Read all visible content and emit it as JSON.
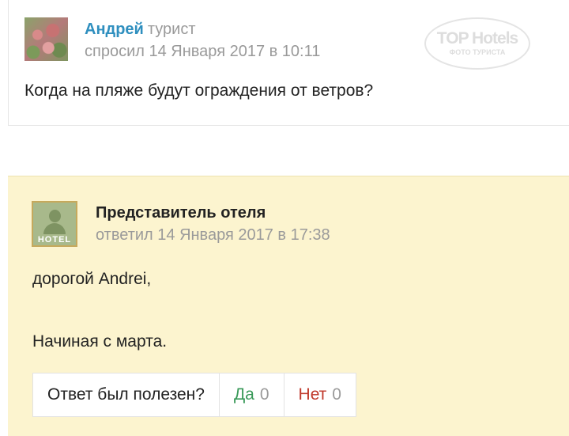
{
  "question": {
    "author_name": "Андрей",
    "author_role": "турист",
    "meta": "спросил 14 Января 2017 в 10:11",
    "text": "Когда на пляже будут ограждения от ветров?",
    "watermark": {
      "main": "TOP Hotels",
      "sub": "ФОТО ТУРИСТА"
    }
  },
  "answer": {
    "avatar_label": "HOTEL",
    "author_name": "Представитель отеля",
    "meta": "ответил 14 Января 2017 в 17:38",
    "greeting": "дорогой Andrei,",
    "text": "Начиная с марта.",
    "helpful": {
      "question": "Ответ был полезен?",
      "yes_label": "Да",
      "yes_count": "0",
      "no_label": "Нет",
      "no_count": "0"
    }
  },
  "colors": {
    "author_link": "#2f8fbf",
    "answer_background": "#fcf4cf",
    "yes": "#3a9a5a",
    "no": "#c0392b",
    "muted": "#9a9a9a"
  },
  "icons": {
    "question_avatar": "user-photo",
    "answer_avatar": "hotel-avatar-icon"
  }
}
